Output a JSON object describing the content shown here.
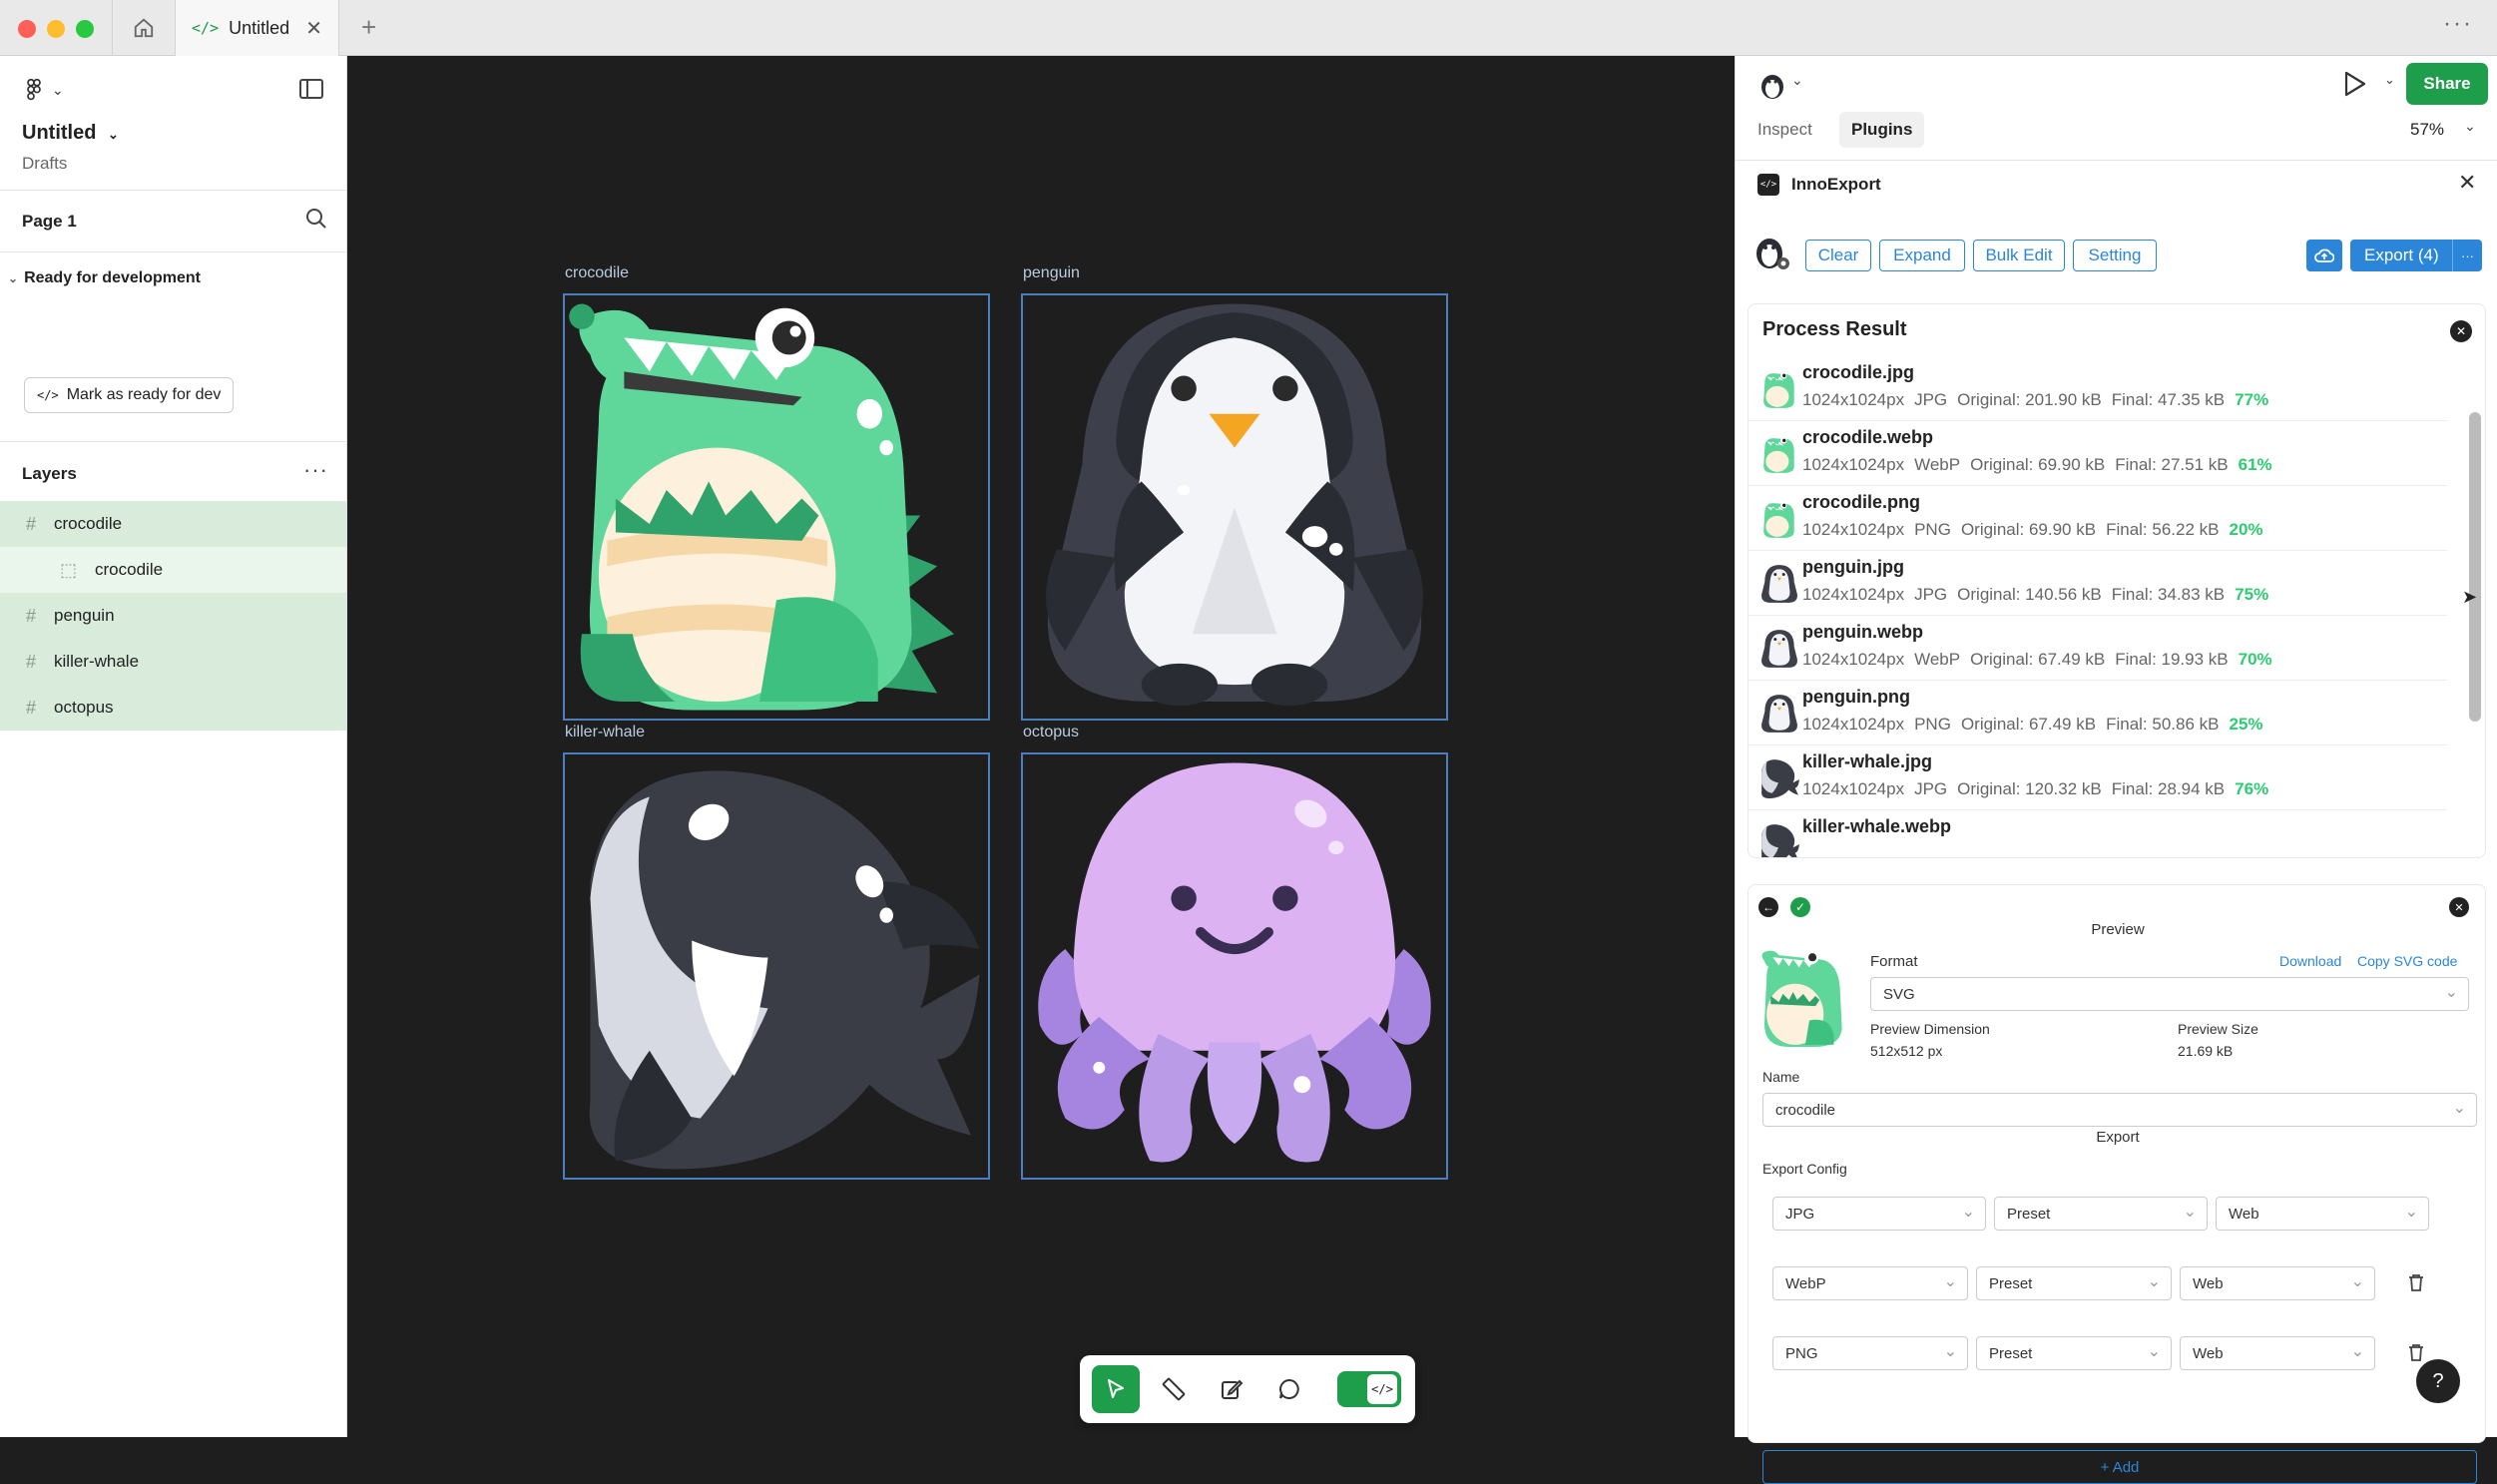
{
  "window": {
    "tab_title": "Untitled",
    "tab_icon": "code-icon",
    "traffic_colors": [
      "#ff5f57",
      "#febc2e",
      "#28c840"
    ]
  },
  "left": {
    "file_title": "Untitled",
    "file_location": "Drafts",
    "page_name": "Page 1",
    "dev_section": "Ready for development",
    "mark_ready_label": "Mark as ready for dev",
    "layers_title": "Layers",
    "layers": [
      {
        "name": "crocodile",
        "indent": 0,
        "selected": true
      },
      {
        "name": "crocodile",
        "indent": 1,
        "selected": true
      },
      {
        "name": "penguin",
        "indent": 0,
        "selected": true
      },
      {
        "name": "killer-whale",
        "indent": 0,
        "selected": true
      },
      {
        "name": "octopus",
        "indent": 0,
        "selected": true
      }
    ]
  },
  "canvas": {
    "frames": [
      {
        "label": "crocodile"
      },
      {
        "label": "penguin"
      },
      {
        "label": "killer-whale"
      },
      {
        "label": "octopus"
      }
    ],
    "frame_border_color": "#4d7fc0"
  },
  "right": {
    "share_label": "Share",
    "tab_inspect": "Inspect",
    "tab_plugins": "Plugins",
    "zoom": "57%",
    "plugin_title": "InnoExport",
    "btn_clear": "Clear",
    "btn_expand": "Expand",
    "btn_bulk_edit": "Bulk Edit",
    "btn_setting": "Setting",
    "btn_export": "Export (4)",
    "process_title": "Process Result",
    "results": [
      {
        "name": "crocodile.jpg",
        "dim": "1024x1024px",
        "fmt": "JPG",
        "original": "Original: 201.90 kB",
        "final": "Final: 47.35 kB",
        "pct": "77%",
        "thumb": "crocodile"
      },
      {
        "name": "crocodile.webp",
        "dim": "1024x1024px",
        "fmt": "WebP",
        "original": "Original: 69.90 kB",
        "final": "Final: 27.51 kB",
        "pct": "61%",
        "thumb": "crocodile"
      },
      {
        "name": "crocodile.png",
        "dim": "1024x1024px",
        "fmt": "PNG",
        "original": "Original: 69.90 kB",
        "final": "Final: 56.22 kB",
        "pct": "20%",
        "thumb": "crocodile"
      },
      {
        "name": "penguin.jpg",
        "dim": "1024x1024px",
        "fmt": "JPG",
        "original": "Original: 140.56 kB",
        "final": "Final: 34.83 kB",
        "pct": "75%",
        "thumb": "penguin"
      },
      {
        "name": "penguin.webp",
        "dim": "1024x1024px",
        "fmt": "WebP",
        "original": "Original: 67.49 kB",
        "final": "Final: 19.93 kB",
        "pct": "70%",
        "thumb": "penguin"
      },
      {
        "name": "penguin.png",
        "dim": "1024x1024px",
        "fmt": "PNG",
        "original": "Original: 67.49 kB",
        "final": "Final: 50.86 kB",
        "pct": "25%",
        "thumb": "penguin"
      },
      {
        "name": "killer-whale.jpg",
        "dim": "1024x1024px",
        "fmt": "JPG",
        "original": "Original: 120.32 kB",
        "final": "Final: 28.94 kB",
        "pct": "76%",
        "thumb": "whale"
      },
      {
        "name": "killer-whale.webp",
        "dim": "",
        "fmt": "",
        "original": "",
        "final": "",
        "pct": "",
        "thumb": "whale"
      }
    ],
    "preview": {
      "title": "Preview",
      "format_label": "Format",
      "download_label": "Download",
      "copy_svg_label": "Copy SVG code",
      "format_value": "SVG",
      "dimension_label": "Preview Dimension",
      "dimension_value": "512x512 px",
      "size_label": "Preview Size",
      "size_value": "21.69 kB",
      "name_label": "Name",
      "name_value": "crocodile"
    },
    "export": {
      "title": "Export",
      "config_label": "Export Config",
      "rows": [
        {
          "format": "JPG",
          "preset": "Preset",
          "target": "Web",
          "deletable": false
        },
        {
          "format": "WebP",
          "preset": "Preset",
          "target": "Web",
          "deletable": true
        },
        {
          "format": "PNG",
          "preset": "Preset",
          "target": "Web",
          "deletable": true
        }
      ],
      "add_label": "+ Add"
    },
    "help_label": "?"
  },
  "colors": {
    "accent_green": "#1e9e4a",
    "accent_blue": "#2b86d9",
    "percent_green": "#2ecc71",
    "layer_selected": "#d9ecdc"
  }
}
